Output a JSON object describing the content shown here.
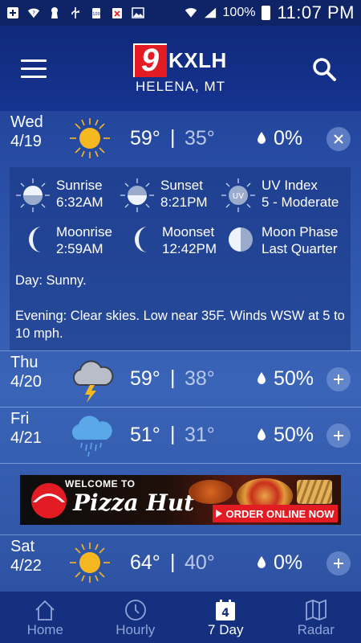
{
  "status_bar": {
    "battery": "100%",
    "time": "11:07 PM",
    "battery_icon_text": "100"
  },
  "header": {
    "logo_number": "9",
    "logo_text": "KXLH",
    "location": "HELENA, MT"
  },
  "days": [
    {
      "name": "Wed",
      "date": "4/19",
      "icon": "sun-icon",
      "hi": "59°",
      "sep": "|",
      "lo": "35°",
      "precip": "0%",
      "expanded": true
    },
    {
      "name": "Thu",
      "date": "4/20",
      "icon": "thunderstorm-icon",
      "hi": "59°",
      "sep": "|",
      "lo": "38°",
      "precip": "50%",
      "expanded": false
    },
    {
      "name": "Fri",
      "date": "4/21",
      "icon": "rain-cloud-icon",
      "hi": "51°",
      "sep": "|",
      "lo": "31°",
      "precip": "50%",
      "expanded": false
    },
    {
      "name": "Sat",
      "date": "4/22",
      "icon": "sun-icon",
      "hi": "64°",
      "sep": "|",
      "lo": "40°",
      "precip": "0%",
      "expanded": false
    }
  ],
  "detail": {
    "sunrise": {
      "label": "Sunrise",
      "value": "6:32AM"
    },
    "sunset": {
      "label": "Sunset",
      "value": "8:21PM"
    },
    "uv": {
      "label": "UV Index",
      "value": "5 - Moderate",
      "icon_text": "UV"
    },
    "moonrise": {
      "label": "Moonrise",
      "value": "2:59AM"
    },
    "moonset": {
      "label": "Moonset",
      "value": "12:42PM"
    },
    "moonphase": {
      "label": "Moon Phase",
      "value": "Last Quarter"
    },
    "day_text": "Day: Sunny.",
    "evening_text": "Evening: Clear skies. Low near 35F. Winds WSW at 5 to 10 mph."
  },
  "ad": {
    "welcome": "WELCOME TO",
    "brand": "Pizza Hut",
    "cta": "ORDER ONLINE NOW"
  },
  "nav": {
    "home": "Home",
    "hourly": "Hourly",
    "seven_day": "7 Day",
    "seven_day_num": "4",
    "radar": "Radar"
  },
  "colors": {
    "background_top": "#1a3a8c",
    "header": "#0f2a7a",
    "accent_red": "#e31c23",
    "sun": "#f6b820",
    "low_temp": "#b8c8e8"
  }
}
